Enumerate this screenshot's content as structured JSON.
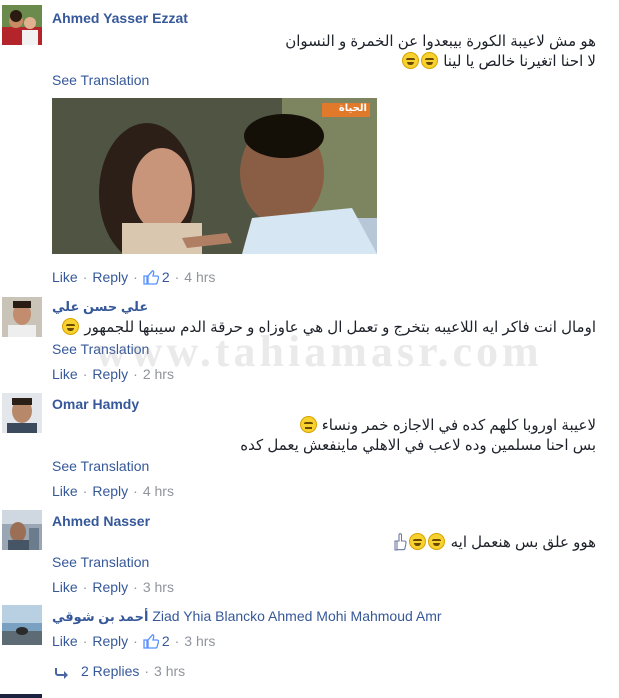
{
  "comments": [
    {
      "author": "Ahmed Yasser Ezzat",
      "lines": [
        "هو مش لاعيبة الكورة بيبعدوا عن الخمرة و النسوان",
        "لا احنا اتغيرنا خالص يا لينا"
      ],
      "see_translation": "See Translation",
      "like": "Like",
      "reply": "Reply",
      "like_count": "2",
      "time": "4 hrs",
      "media_logo": "الحياة"
    },
    {
      "author": "علي حسن علي",
      "lines": [
        "اومال انت فاكر ايه اللاعيبه بتخرج و تعمل ال هي عاوزاه و حرقة الدم سيبنها للجمهور"
      ],
      "see_translation": "See Translation",
      "like": "Like",
      "reply": "Reply",
      "time": "2 hrs"
    },
    {
      "author": "Omar Hamdy",
      "lines": [
        "لاعيبة اوروبا كلهم كده في الاجازه خمر ونساء",
        "بس احنا مسلمين وده لاعب في الاهلي ماينفعش يعمل كده"
      ],
      "see_translation": "See Translation",
      "like": "Like",
      "reply": "Reply",
      "time": "4 hrs"
    },
    {
      "author": "Ahmed Nasser",
      "lines": [
        "هوو علق بس هنعمل ايه"
      ],
      "see_translation": "See Translation",
      "like": "Like",
      "reply": "Reply",
      "time": "3 hrs"
    },
    {
      "author": "أحمد بن شوقي",
      "tags": "Ziad Yhia Blancko Ahmed Mohi Mahmoud Amr",
      "like": "Like",
      "reply": "Reply",
      "like_count": "2",
      "time": "3 hrs",
      "replies_label": "2 Replies",
      "replies_time": "3 hrs"
    }
  ],
  "watermark": "www.tahiamasr.com",
  "colors": {
    "link": "#365899",
    "meta": "#90949c",
    "text": "#1d2129",
    "like_icon": "#5890ff"
  },
  "icons": [
    "laughing-emoji-icon",
    "neutral-emoji-icon",
    "thumbs-up-icon",
    "hand-pointing-icon",
    "reply-arrow-icon"
  ]
}
